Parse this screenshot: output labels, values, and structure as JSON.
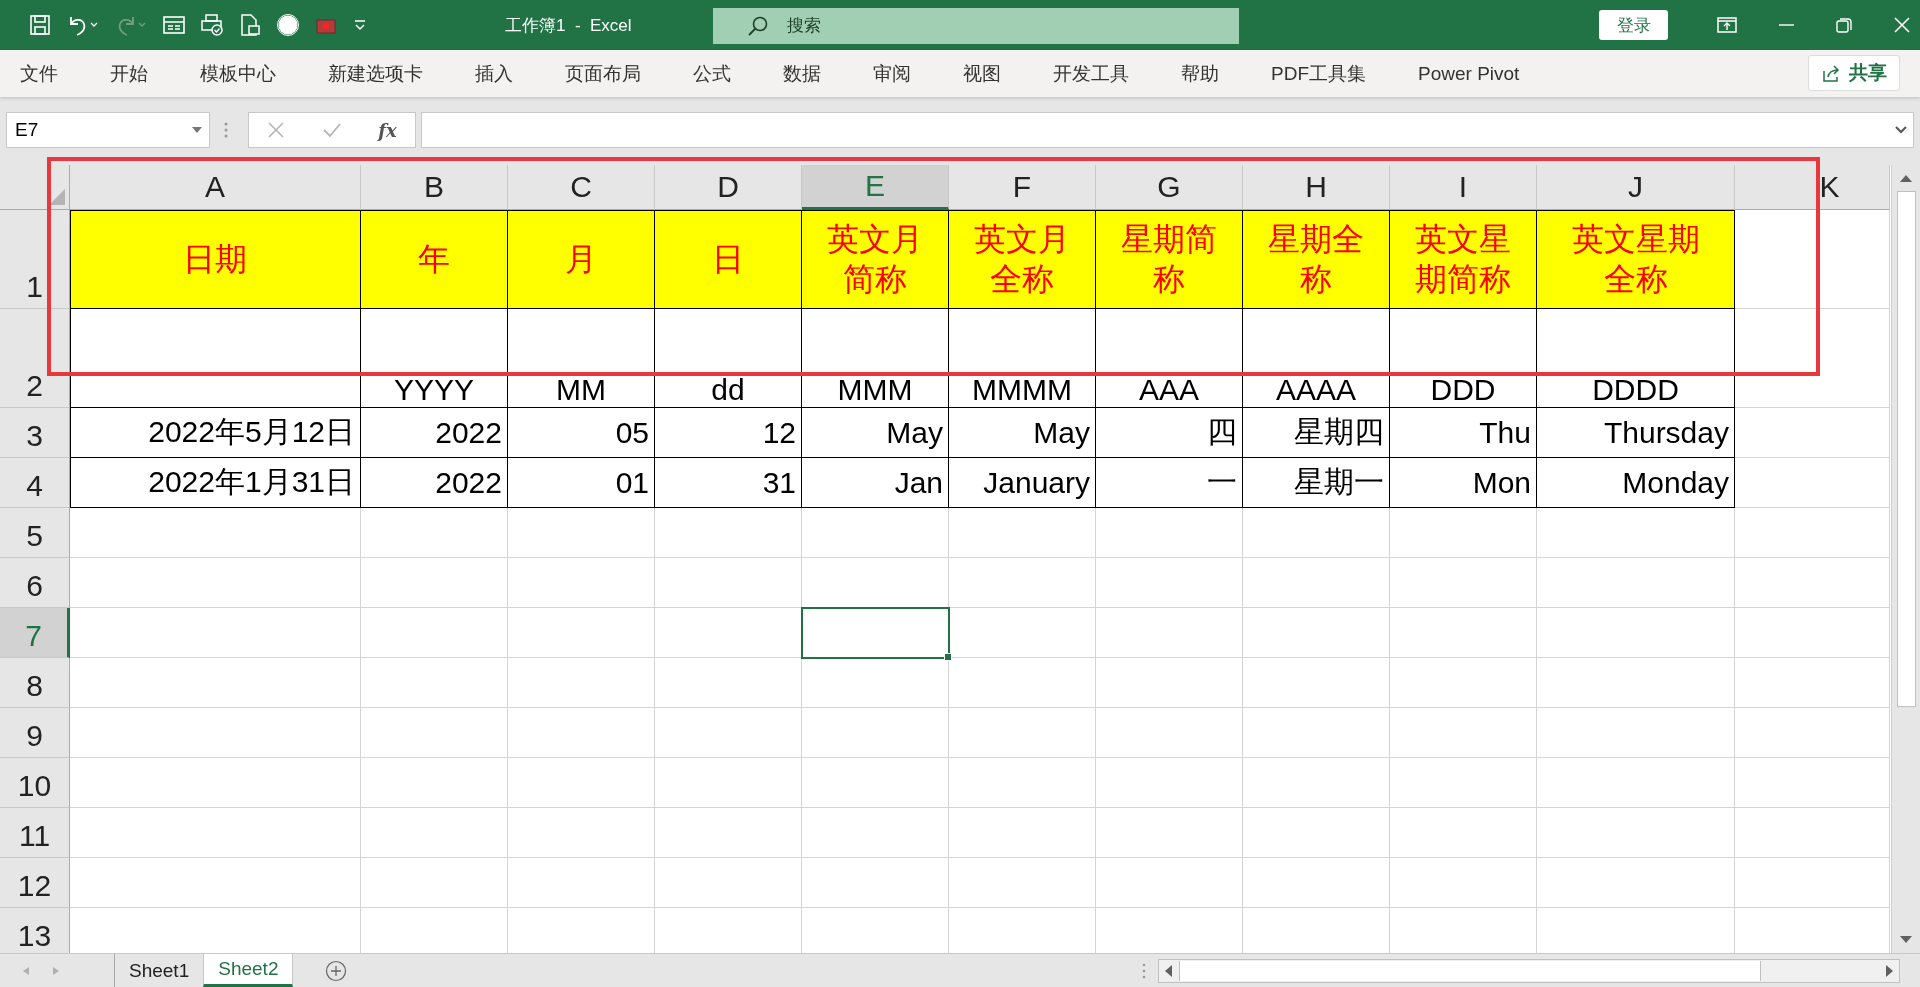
{
  "title_bar": {
    "title": "工作簿1  -  Excel",
    "search": {
      "placeholder": "搜索"
    },
    "sign_in": "登录"
  },
  "ribbon": {
    "tabs": [
      {
        "label": "文件"
      },
      {
        "label": "开始"
      },
      {
        "label": "模板中心"
      },
      {
        "label": "新建选项卡"
      },
      {
        "label": "插入"
      },
      {
        "label": "页面布局"
      },
      {
        "label": "公式"
      },
      {
        "label": "数据"
      },
      {
        "label": "审阅"
      },
      {
        "label": "视图"
      },
      {
        "label": "开发工具"
      },
      {
        "label": "帮助"
      },
      {
        "label": "PDF工具集"
      },
      {
        "label": "Power Pivot"
      }
    ],
    "share": "共享"
  },
  "formula_bar": {
    "name_box": "E7",
    "function_label": "fx"
  },
  "grid": {
    "columns": [
      {
        "label": "A",
        "selected": false
      },
      {
        "label": "B",
        "selected": false
      },
      {
        "label": "C",
        "selected": false
      },
      {
        "label": "D",
        "selected": false
      },
      {
        "label": "E",
        "selected": true
      },
      {
        "label": "F",
        "selected": false
      },
      {
        "label": "G",
        "selected": false
      },
      {
        "label": "H",
        "selected": false
      },
      {
        "label": "I",
        "selected": false
      },
      {
        "label": "J",
        "selected": false
      },
      {
        "label": "K",
        "selected": false
      }
    ],
    "rows": [
      {
        "label": "1",
        "kind": "title",
        "selected": false,
        "cells": [
          "日期",
          "年",
          "月",
          "日",
          "英文月简称",
          "英文月全称",
          "星期简称",
          "星期全称",
          "英文星期简称",
          "英文星期全称"
        ]
      },
      {
        "label": "2",
        "kind": "format",
        "selected": false,
        "cells": [
          "",
          "YYYY",
          "MM",
          "dd",
          "MMM",
          "MMMM",
          "AAA",
          "AAAA",
          "DDD",
          "DDDD"
        ]
      },
      {
        "label": "3",
        "kind": "data",
        "selected": false,
        "cells": [
          "2022年5月12日",
          "2022",
          "05",
          "12",
          "May",
          "May",
          "四",
          "星期四",
          "Thu",
          "Thursday"
        ]
      },
      {
        "label": "4",
        "kind": "data",
        "selected": false,
        "cells": [
          "2022年1月31日",
          "2022",
          "01",
          "31",
          "Jan",
          "January",
          "一",
          "星期一",
          "Mon",
          "Monday"
        ]
      },
      {
        "label": "5",
        "kind": "empty",
        "selected": false
      },
      {
        "label": "6",
        "kind": "empty",
        "selected": false
      },
      {
        "label": "7",
        "kind": "empty",
        "selected": true
      },
      {
        "label": "8",
        "kind": "empty",
        "selected": false
      },
      {
        "label": "9",
        "kind": "empty",
        "selected": false
      },
      {
        "label": "10",
        "kind": "empty",
        "selected": false
      },
      {
        "label": "11",
        "kind": "empty",
        "selected": false
      },
      {
        "label": "12",
        "kind": "empty",
        "selected": false
      },
      {
        "label": "13",
        "kind": "empty",
        "selected": false
      }
    ]
  },
  "sheet_tabs": [
    {
      "label": "Sheet1",
      "selected": false
    },
    {
      "label": "Sheet2",
      "selected": true
    }
  ]
}
